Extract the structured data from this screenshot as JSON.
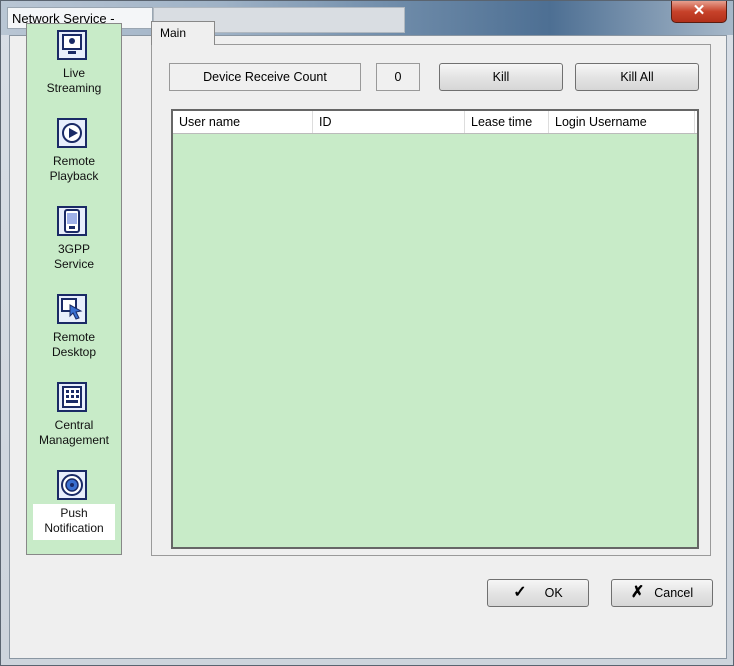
{
  "window": {
    "title": "Network Service -",
    "close_glyph": "✕"
  },
  "sidebar": {
    "items": [
      {
        "label_line1": "Live",
        "label_line2": "Streaming",
        "icon": "monitor-icon"
      },
      {
        "label_line1": "Remote",
        "label_line2": "Playback",
        "icon": "playback-icon"
      },
      {
        "label_line1": "3GPP",
        "label_line2": "Service",
        "icon": "phone-icon"
      },
      {
        "label_line1": "Remote",
        "label_line2": "Desktop",
        "icon": "remote-desktop-icon"
      },
      {
        "label_line1": "Central",
        "label_line2": "Management",
        "icon": "building-icon"
      },
      {
        "label_line1": "Push",
        "label_line2": "Notification",
        "icon": "push-notification-icon"
      }
    ],
    "active_index": 5
  },
  "tabs": [
    {
      "label": "Main"
    }
  ],
  "counter": {
    "label": "Device Receive Count",
    "value": "0"
  },
  "buttons": {
    "kill": "Kill",
    "kill_all": "Kill All",
    "ok": "OK",
    "ok_glyph": "✓",
    "cancel": "Cancel",
    "cancel_glyph": "✗"
  },
  "table": {
    "columns": [
      "User name",
      "ID",
      "Lease time",
      "Login Username"
    ],
    "rows": []
  },
  "colors": {
    "panel_green": "#c8ebc8",
    "close_red": "#c7422a"
  }
}
